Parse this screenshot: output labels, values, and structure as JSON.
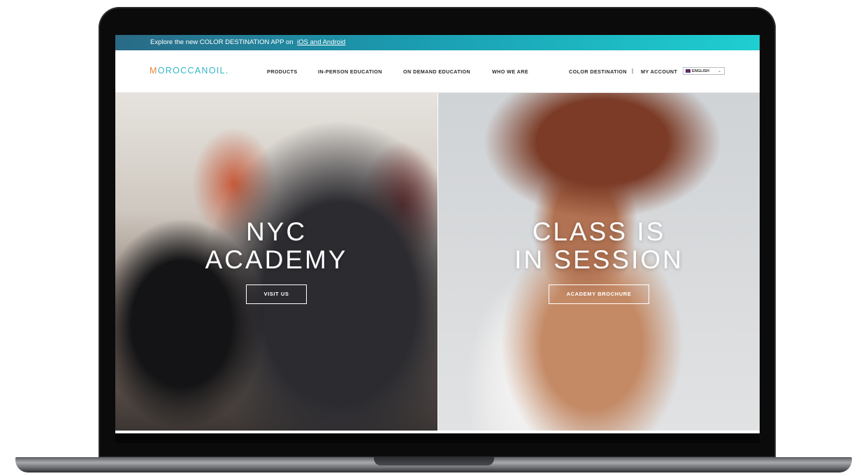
{
  "announcement": {
    "text": "Explore the new COLOR DESTINATION APP on",
    "link": "iOS and Android"
  },
  "header": {
    "logo_first": "M",
    "logo_rest": "OROCCANOIL.",
    "nav": [
      "PRODUCTS",
      "IN-PERSON EDUCATION",
      "ON DEMAND EDUCATION",
      "WHO WE ARE"
    ],
    "color_destination": "COLOR DESTINATION",
    "separator": "|",
    "my_account": "MY ACCOUNT",
    "language": "ENGLISH"
  },
  "hero": {
    "left": {
      "line1": "NYC",
      "line2": "ACADEMY",
      "button": "VISIT US"
    },
    "right": {
      "line1": "CLASS IS",
      "line2": "IN SESSION",
      "button": "ACADEMY BROCHURE"
    }
  },
  "colors": {
    "announce_start": "#2a6a86",
    "announce_end": "#1fcfd1",
    "logo_teal": "#30b8c8",
    "logo_orange": "#e8863a"
  }
}
